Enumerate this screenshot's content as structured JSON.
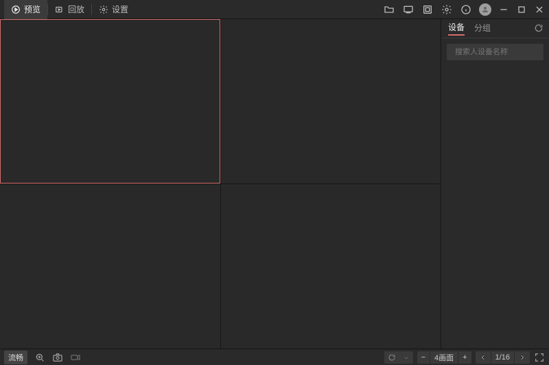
{
  "header": {
    "tabs": [
      {
        "label": "预览",
        "icon": "play-circle",
        "active": true
      },
      {
        "label": "回放",
        "icon": "playback"
      },
      {
        "label": "设置",
        "icon": "gear"
      }
    ],
    "icons": [
      "folder",
      "screen",
      "monitor",
      "gear",
      "info"
    ],
    "window_controls": [
      "minimize",
      "maximize",
      "close"
    ]
  },
  "grid": {
    "rows": 2,
    "cols": 2,
    "selected_index": 0
  },
  "sidebar": {
    "tabs": [
      {
        "label": "设备",
        "active": true
      },
      {
        "label": "分组"
      }
    ],
    "search_placeholder": "搜索人设备名称"
  },
  "footer": {
    "stream_quality": "流畅",
    "layout_label": "4画面",
    "page_label": "1/16"
  }
}
